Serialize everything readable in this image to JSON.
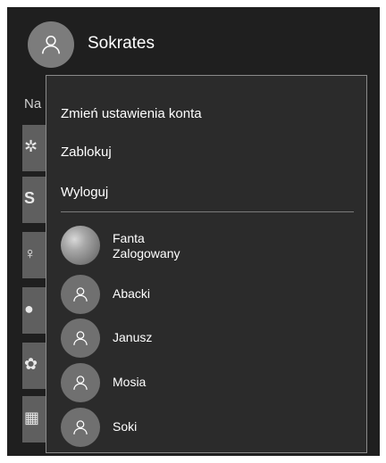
{
  "header": {
    "user_name": "Sokrates",
    "section_partial": "Na"
  },
  "flyout": {
    "menu": [
      {
        "label": "Zmień ustawienia konta"
      },
      {
        "label": "Zablokuj"
      },
      {
        "label": "Wyloguj"
      }
    ],
    "accounts": [
      {
        "name": "Fanta",
        "status": "Zalogowany",
        "icon": "photo-avatar"
      },
      {
        "name": "Abacki",
        "icon": "person-icon"
      },
      {
        "name": "Janusz",
        "icon": "person-icon"
      },
      {
        "name": "Mosia",
        "icon": "person-icon"
      },
      {
        "name": "Soki",
        "icon": "person-icon"
      }
    ]
  },
  "colors": {
    "panel_bg": "#1f1f1f",
    "flyout_bg": "#2b2b2b",
    "avatar_bg": "#707070",
    "border": "#8a8a8a"
  }
}
